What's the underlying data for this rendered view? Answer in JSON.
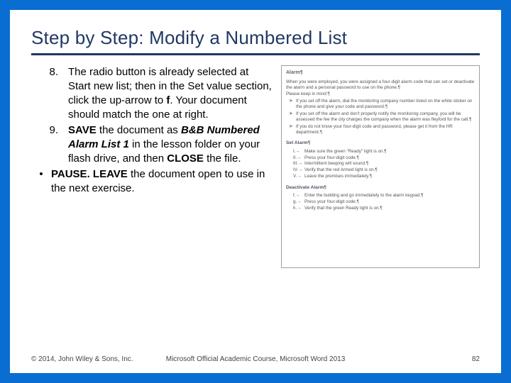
{
  "title": "Step by Step: Modify a Numbered List",
  "steps": {
    "s8": {
      "num": "8.",
      "a": "The radio button is already selected at Start new list; then in the Set value section, click the up-arrow to ",
      "b": "f",
      "c": ". Your document should match the one at right."
    },
    "s9": {
      "num": "9.",
      "a": "SAVE",
      "b": " the document as ",
      "c": "B&B Numbered Alarm List 1",
      "d": " in the lesson folder on your flash drive, and then ",
      "e": "CLOSE",
      "f": " the file."
    },
    "bullet": {
      "dot": "•",
      "a": "PAUSE. LEAVE",
      "b": " the document open to use in the next exercise."
    }
  },
  "figure": {
    "heading": "Alarm¶",
    "p1": "When you were employed, you were assigned a four-digit alarm code that can set or deactivate the alarm and a personal password to use on the phone.¶",
    "p2": "Please keep in mind:¶",
    "list1": [
      "If you set off the alarm, dial the monitoring company number listed on the white sticker on the phone and give your code and password.¶",
      "If you set off the alarm and don't properly notify the monitoring company, you will be assessed the fee the city charges the company when the alarm was fleyford for the call.¶",
      "If you do not know your four-digit code and password, please get it from the HR department.¶"
    ],
    "sub1": "Set Alarm¶",
    "num1": [
      {
        "n": "I.→",
        "t": "Make sure the green \"Ready\" light is on.¶"
      },
      {
        "n": "II.→",
        "t": "Press your four-digit code.¶"
      },
      {
        "n": "III.→",
        "t": "Intermittent beeping will sound.¶"
      },
      {
        "n": "IV.→",
        "t": "Verify that the red Armed light is on.¶"
      },
      {
        "n": "V.→",
        "t": "Leave the premises immediately.¶"
      }
    ],
    "sub2": "Deactivate Alarm¶",
    "num2": [
      {
        "n": "f.→",
        "t": "Enter the building and go immediately to the alarm keypad.¶"
      },
      {
        "n": "g.→",
        "t": "Press your four-digit code.¶"
      },
      {
        "n": "h.→",
        "t": "Verify that the green Ready light is on.¶"
      }
    ]
  },
  "footer": {
    "left": "© 2014, John Wiley & Sons, Inc.",
    "center": "Microsoft Official Academic Course, Microsoft Word 2013",
    "right": "82"
  }
}
